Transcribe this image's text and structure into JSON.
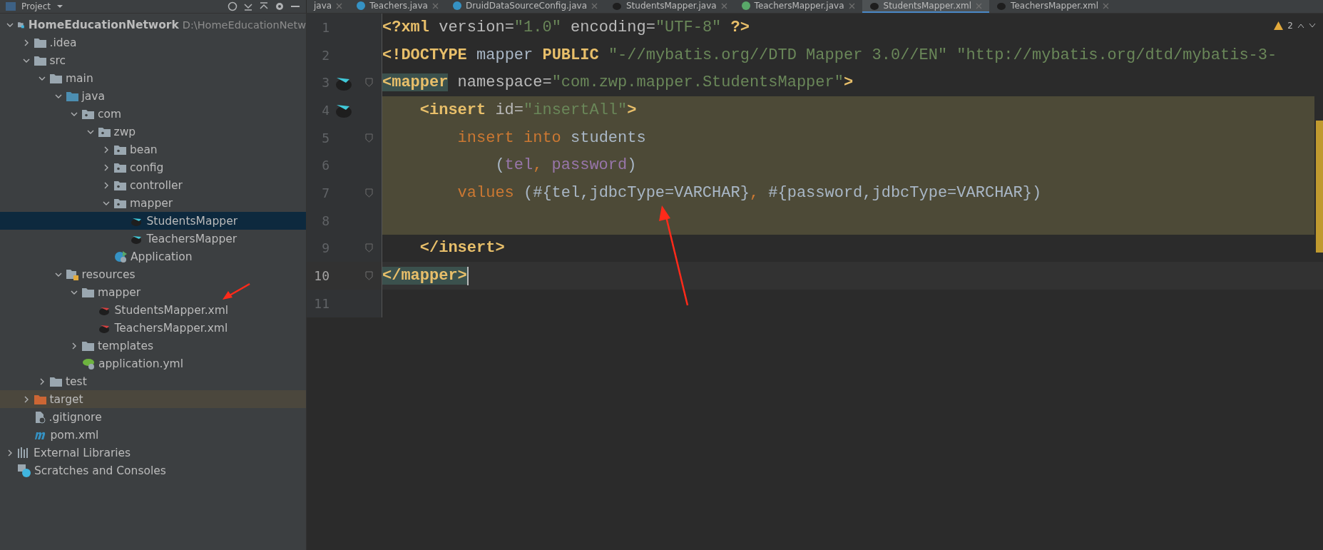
{
  "project_panel": {
    "title": "Project"
  },
  "tabs": [
    {
      "label": "java",
      "kind": "plain",
      "selected": false
    },
    {
      "label": "Teachers.java",
      "kind": "class",
      "selected": false
    },
    {
      "label": "DruidDataSourceConfig.java",
      "kind": "class",
      "selected": false
    },
    {
      "label": "StudentsMapper.java",
      "kind": "mapper",
      "selected": false
    },
    {
      "label": "TeachersMapper.java",
      "kind": "interface",
      "selected": false
    },
    {
      "label": "StudentsMapper.xml",
      "kind": "xml",
      "selected": true
    },
    {
      "label": "TeachersMapper.xml",
      "kind": "xml",
      "selected": false
    }
  ],
  "tree": [
    {
      "label": "HomeEducationNetwork",
      "path": "D:\\HomeEducationNetw",
      "kind": "project",
      "expanded": true,
      "selected": false,
      "excluded": false,
      "children": [
        {
          "label": ".idea",
          "kind": "folder",
          "expanded": false,
          "selected": false,
          "excluded": false
        },
        {
          "label": "src",
          "kind": "folder",
          "expanded": true,
          "selected": false,
          "excluded": false,
          "children": [
            {
              "label": "main",
              "kind": "folder",
              "expanded": true,
              "selected": false,
              "excluded": false,
              "children": [
                {
                  "label": "java",
                  "kind": "source",
                  "expanded": true,
                  "selected": false,
                  "excluded": false,
                  "children": [
                    {
                      "label": "com",
                      "kind": "package",
                      "expanded": true,
                      "selected": false,
                      "excluded": false,
                      "children": [
                        {
                          "label": "zwp",
                          "kind": "package",
                          "expanded": true,
                          "selected": false,
                          "excluded": false,
                          "children": [
                            {
                              "label": "bean",
                              "kind": "package",
                              "expanded": false,
                              "selected": false,
                              "excluded": false
                            },
                            {
                              "label": "config",
                              "kind": "package",
                              "expanded": false,
                              "selected": false,
                              "excluded": false
                            },
                            {
                              "label": "controller",
                              "kind": "package",
                              "expanded": false,
                              "selected": false,
                              "excluded": false
                            },
                            {
                              "label": "mapper",
                              "kind": "package",
                              "expanded": true,
                              "selected": false,
                              "excluded": false,
                              "children": [
                                {
                                  "label": "StudentsMapper",
                                  "kind": "mapper",
                                  "selected": true,
                                  "excluded": false
                                },
                                {
                                  "label": "TeachersMapper",
                                  "kind": "mapper",
                                  "selected": false,
                                  "excluded": false
                                }
                              ]
                            },
                            {
                              "label": "Application",
                              "kind": "app",
                              "selected": false,
                              "excluded": false
                            }
                          ]
                        }
                      ]
                    }
                  ]
                },
                {
                  "label": "resources",
                  "kind": "resources",
                  "expanded": true,
                  "selected": false,
                  "excluded": false,
                  "children": [
                    {
                      "label": "mapper",
                      "kind": "folder",
                      "expanded": true,
                      "selected": false,
                      "excluded": false,
                      "children": [
                        {
                          "label": "StudentsMapper.xml",
                          "kind": "xml",
                          "selected": false,
                          "excluded": false
                        },
                        {
                          "label": "TeachersMapper.xml",
                          "kind": "xml",
                          "selected": false,
                          "excluded": false
                        }
                      ]
                    },
                    {
                      "label": "templates",
                      "kind": "folder",
                      "expanded": false,
                      "selected": false,
                      "excluded": false
                    },
                    {
                      "label": "application.yml",
                      "kind": "yml",
                      "selected": false,
                      "excluded": false
                    }
                  ]
                }
              ]
            },
            {
              "label": "test",
              "kind": "folder",
              "expanded": false,
              "selected": false,
              "excluded": false
            }
          ]
        },
        {
          "label": "target",
          "kind": "excluded-folder",
          "expanded": false,
          "selected": false,
          "excluded": true
        },
        {
          "label": ".gitignore",
          "kind": "gitignore",
          "selected": false,
          "excluded": false
        },
        {
          "label": "pom.xml",
          "kind": "maven",
          "selected": false,
          "excluded": false
        }
      ]
    },
    {
      "label": "External Libraries",
      "kind": "libraries",
      "expanded": false,
      "selected": false,
      "excluded": false
    },
    {
      "label": "Scratches and Consoles",
      "kind": "scratches",
      "selected": false,
      "excluded": false
    }
  ],
  "editor": {
    "warnings": "2",
    "lines": [
      {
        "number": "1",
        "kind": "root",
        "gutter_icon": false,
        "fold": false,
        "highlighted": false,
        "current": false,
        "tokens": [
          {
            "kind": "tag",
            "text": "<?xml "
          },
          {
            "kind": "attr",
            "text": "version="
          },
          {
            "kind": "string",
            "text": "\"1.0\" "
          },
          {
            "kind": "attr",
            "text": "encoding="
          },
          {
            "kind": "string",
            "text": "\"UTF-8\" "
          },
          {
            "kind": "tag",
            "text": "?>"
          }
        ]
      },
      {
        "number": "2",
        "kind": "root",
        "gutter_icon": false,
        "fold": false,
        "highlighted": false,
        "current": false,
        "tokens": [
          {
            "kind": "tag",
            "text": "<!DOCTYPE "
          },
          {
            "kind": "plain",
            "text": "mapper "
          },
          {
            "kind": "tag",
            "text": "PUBLIC "
          },
          {
            "kind": "string",
            "text": "\"-//mybatis.org//DTD Mapper 3.0//EN\" \"http://mybatis.org/dtd/mybatis-3-"
          }
        ]
      },
      {
        "number": "3",
        "kind": "root",
        "gutter_icon": true,
        "fold": true,
        "highlighted": false,
        "current": false,
        "tokens": [
          {
            "kind": "matched",
            "text": "<mapper"
          },
          {
            "kind": "attr",
            "text": " namespace="
          },
          {
            "kind": "string",
            "text": "\"com.zwp.mapper.StudentsMapper\""
          },
          {
            "kind": "tag",
            "text": ">"
          }
        ]
      },
      {
        "number": "4",
        "kind": "element",
        "gutter_icon": true,
        "fold": false,
        "highlighted": true,
        "current": false,
        "tokens": [
          {
            "kind": "tag",
            "text": "<insert "
          },
          {
            "kind": "attr",
            "text": "id="
          },
          {
            "kind": "string",
            "text": "\"insertAll\""
          },
          {
            "kind": "tag",
            "text": ">"
          }
        ]
      },
      {
        "number": "5",
        "kind": "statement",
        "gutter_icon": false,
        "fold": true,
        "highlighted": true,
        "current": false,
        "tokens": [
          {
            "kind": "keyword",
            "text": "insert into "
          },
          {
            "kind": "plain",
            "text": "students"
          }
        ]
      },
      {
        "number": "6",
        "kind": "continuation",
        "gutter_icon": false,
        "fold": false,
        "highlighted": true,
        "current": false,
        "tokens": [
          {
            "kind": "plain",
            "text": "("
          },
          {
            "kind": "param",
            "text": "tel"
          },
          {
            "kind": "keyword",
            "text": ", "
          },
          {
            "kind": "param",
            "text": "password"
          },
          {
            "kind": "plain",
            "text": ")"
          }
        ]
      },
      {
        "number": "7",
        "kind": "statement",
        "gutter_icon": false,
        "fold": true,
        "highlighted": true,
        "current": false,
        "tokens": [
          {
            "kind": "keyword",
            "text": "values "
          },
          {
            "kind": "plain",
            "text": "(#{tel,jdbcType=VARCHAR}"
          },
          {
            "kind": "keyword",
            "text": ", "
          },
          {
            "kind": "plain",
            "text": "#{password,jdbcType=VARCHAR})"
          }
        ]
      },
      {
        "number": "8",
        "gutter_icon": false,
        "fold": false,
        "highlighted": true,
        "current": false
      },
      {
        "number": "9",
        "kind": "element",
        "gutter_icon": false,
        "fold": true,
        "highlighted": false,
        "current": false,
        "tokens": [
          {
            "kind": "tag",
            "text": "</insert>"
          }
        ]
      },
      {
        "number": "10",
        "kind": "root",
        "gutter_icon": false,
        "fold": true,
        "highlighted": false,
        "current": true,
        "tokens": [
          {
            "kind": "matched",
            "text": "</mapper>"
          }
        ]
      },
      {
        "number": "11",
        "gutter_icon": false,
        "fold": false,
        "highlighted": false,
        "current": false
      }
    ]
  }
}
